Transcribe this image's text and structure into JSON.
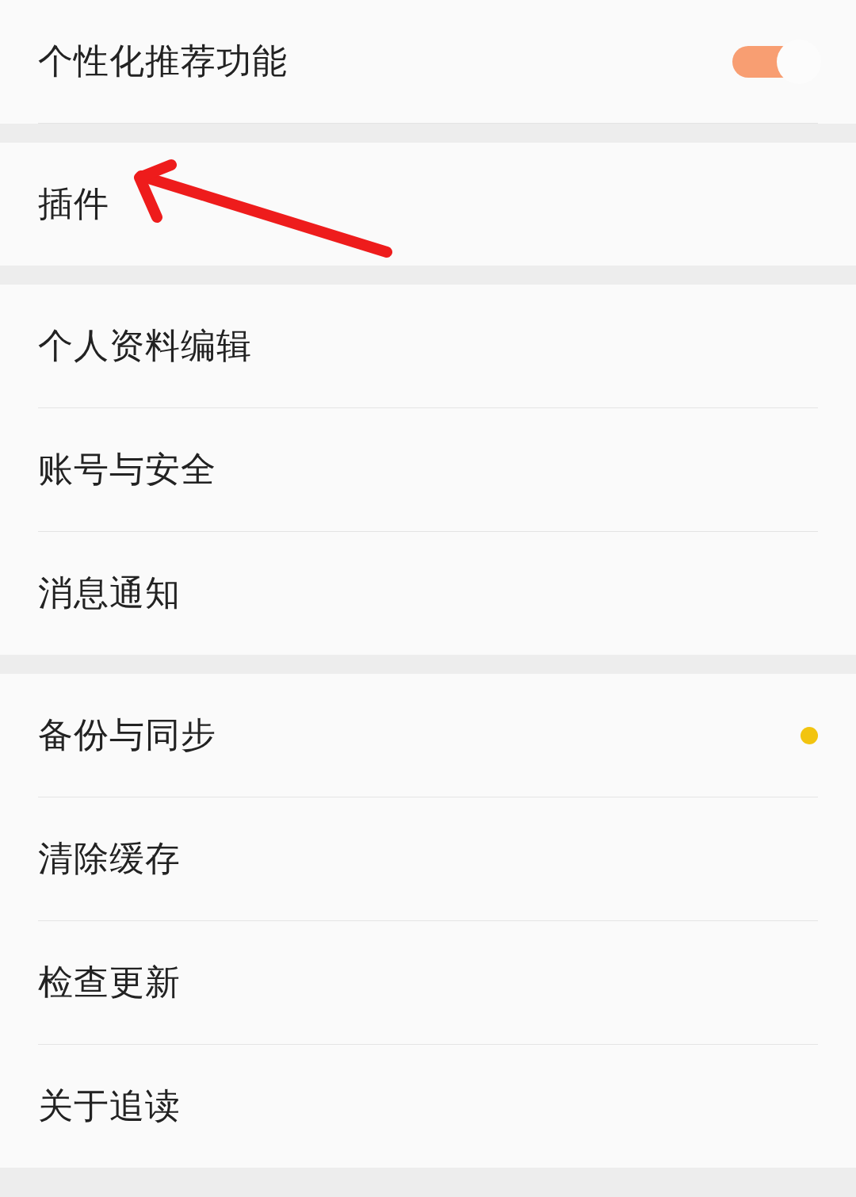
{
  "groups": [
    {
      "items": [
        {
          "label": "个性化推荐功能",
          "kind": "toggle",
          "on": true
        }
      ]
    },
    {
      "items": [
        {
          "label": "插件",
          "kind": "plain"
        }
      ]
    },
    {
      "items": [
        {
          "label": "个人资料编辑",
          "kind": "plain"
        },
        {
          "label": "账号与安全",
          "kind": "plain"
        },
        {
          "label": "消息通知",
          "kind": "plain"
        }
      ]
    },
    {
      "items": [
        {
          "label": "备份与同步",
          "kind": "dot",
          "color": "#f2c40f"
        },
        {
          "label": "清除缓存",
          "kind": "plain"
        },
        {
          "label": "检查更新",
          "kind": "plain"
        },
        {
          "label": "关于追读",
          "kind": "plain"
        }
      ]
    }
  ]
}
